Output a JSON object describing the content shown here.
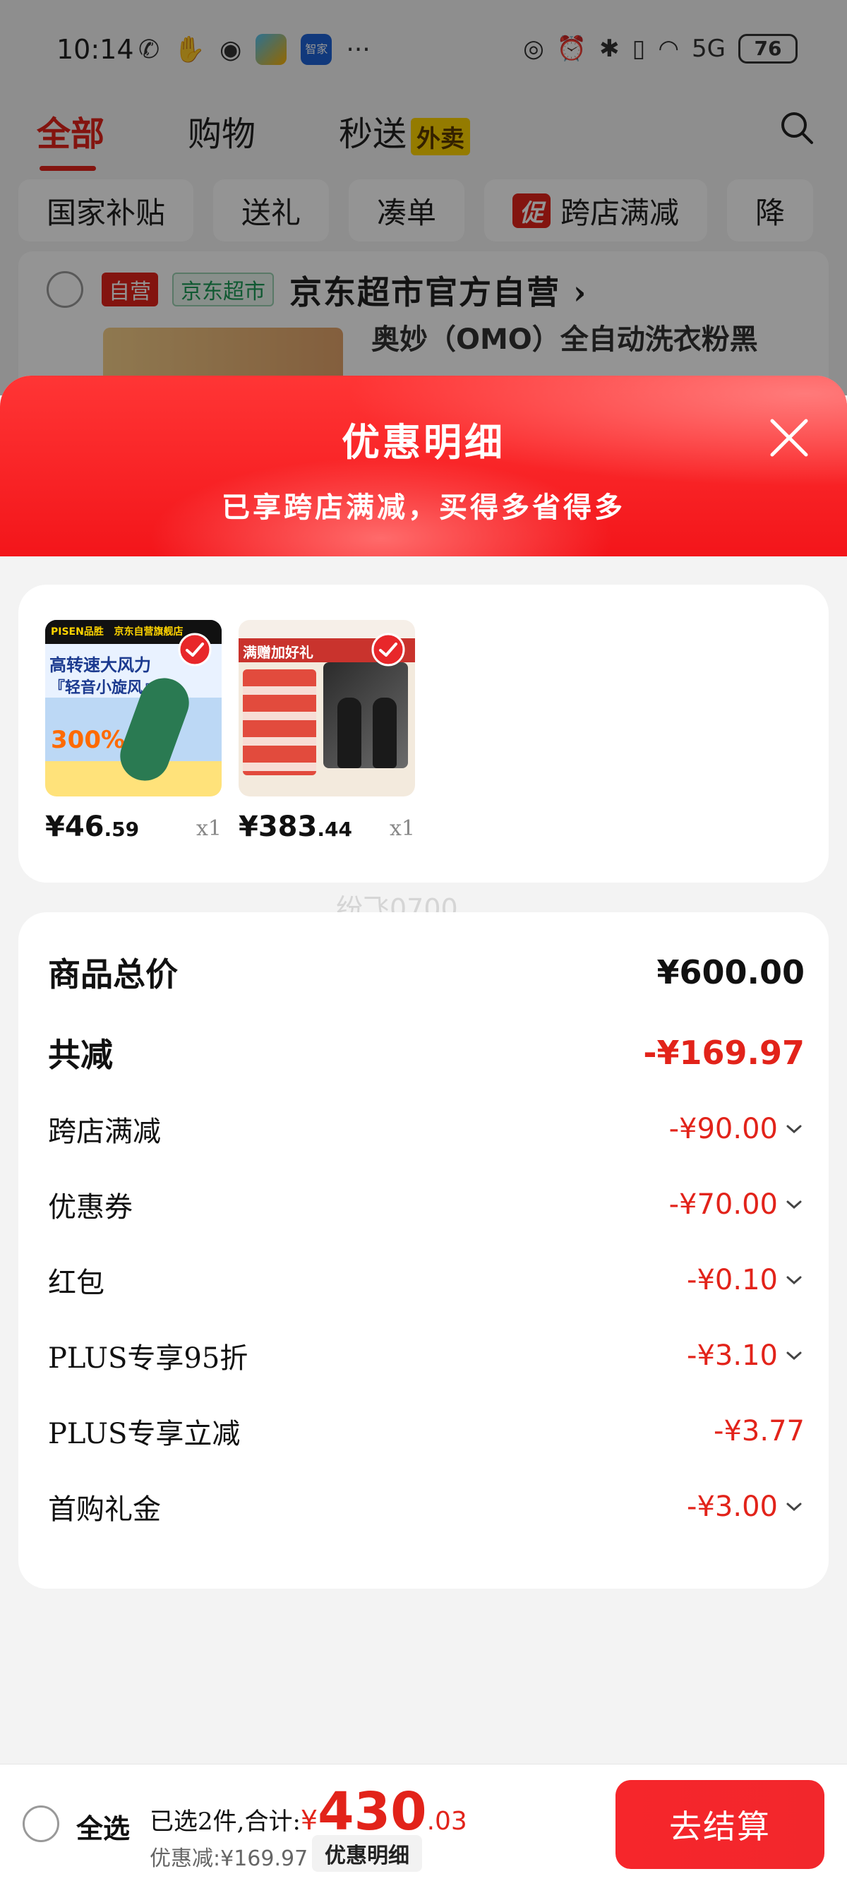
{
  "status_bar": {
    "time": "10:14",
    "home_app_label": "智家",
    "more": "···",
    "network": "5G",
    "battery": "76"
  },
  "top_tabs": [
    {
      "label": "全部"
    },
    {
      "label": "购物"
    },
    {
      "label": "秒送",
      "badge": "外卖"
    }
  ],
  "chips": [
    {
      "label": "国家补贴"
    },
    {
      "label": "送礼"
    },
    {
      "label": "凑单"
    },
    {
      "label": "跨店满减",
      "tag": "促"
    },
    {
      "label": "降"
    }
  ],
  "store": {
    "tag_ziying": "自营",
    "tag_chaoshi": "京东超市",
    "name": "京东超市官方自营 ›",
    "product_title_partial": "奥妙（OMO）全自动洗衣粉黑"
  },
  "sheet": {
    "title": "优惠明细",
    "subtitle": "已享跨店满减，买得多省得多"
  },
  "items": [
    {
      "price_int": "¥46",
      "price_dec": ".59",
      "qty": "x1",
      "img_brand": "PISEN品胜",
      "img_store": "京东自营旗舰店",
      "img_line1": "高转速大风力",
      "img_line2": "『轻音小旋风』",
      "img_pct": "300%"
    },
    {
      "price_int": "¥383",
      "price_dec": ".44",
      "qty": "x1",
      "img_title": "满赠加好礼"
    }
  ],
  "watermark": "纷飞0700",
  "details": {
    "total_label": "商品总价",
    "total_value": "¥600.00",
    "reduce_label": "共减",
    "reduce_value": "-¥169.97",
    "rows": [
      {
        "label": "跨店满减",
        "value": "-¥90.00",
        "expandable": true
      },
      {
        "label": "优惠券",
        "value": "-¥70.00",
        "expandable": true
      },
      {
        "label": "红包",
        "value": "-¥0.10",
        "expandable": true
      },
      {
        "label": "PLUS专享95折",
        "value": "-¥3.10",
        "expandable": true
      },
      {
        "label": "PLUS专享立减",
        "value": "-¥3.77",
        "expandable": false
      },
      {
        "label": "首购礼金",
        "value": "-¥3.00",
        "expandable": true
      }
    ]
  },
  "bottom": {
    "select_all": "全选",
    "selected_text": "已选2件,合计:",
    "yen": "¥",
    "total_int": "430",
    "total_dec": ".03",
    "discount_text": "优惠减:¥169.97",
    "detail_link": "优惠明细",
    "checkout": "去结算"
  },
  "colors": {
    "accent": "#e2231a",
    "sheet_header": "#f3151a",
    "checkout": "#f4262b"
  }
}
